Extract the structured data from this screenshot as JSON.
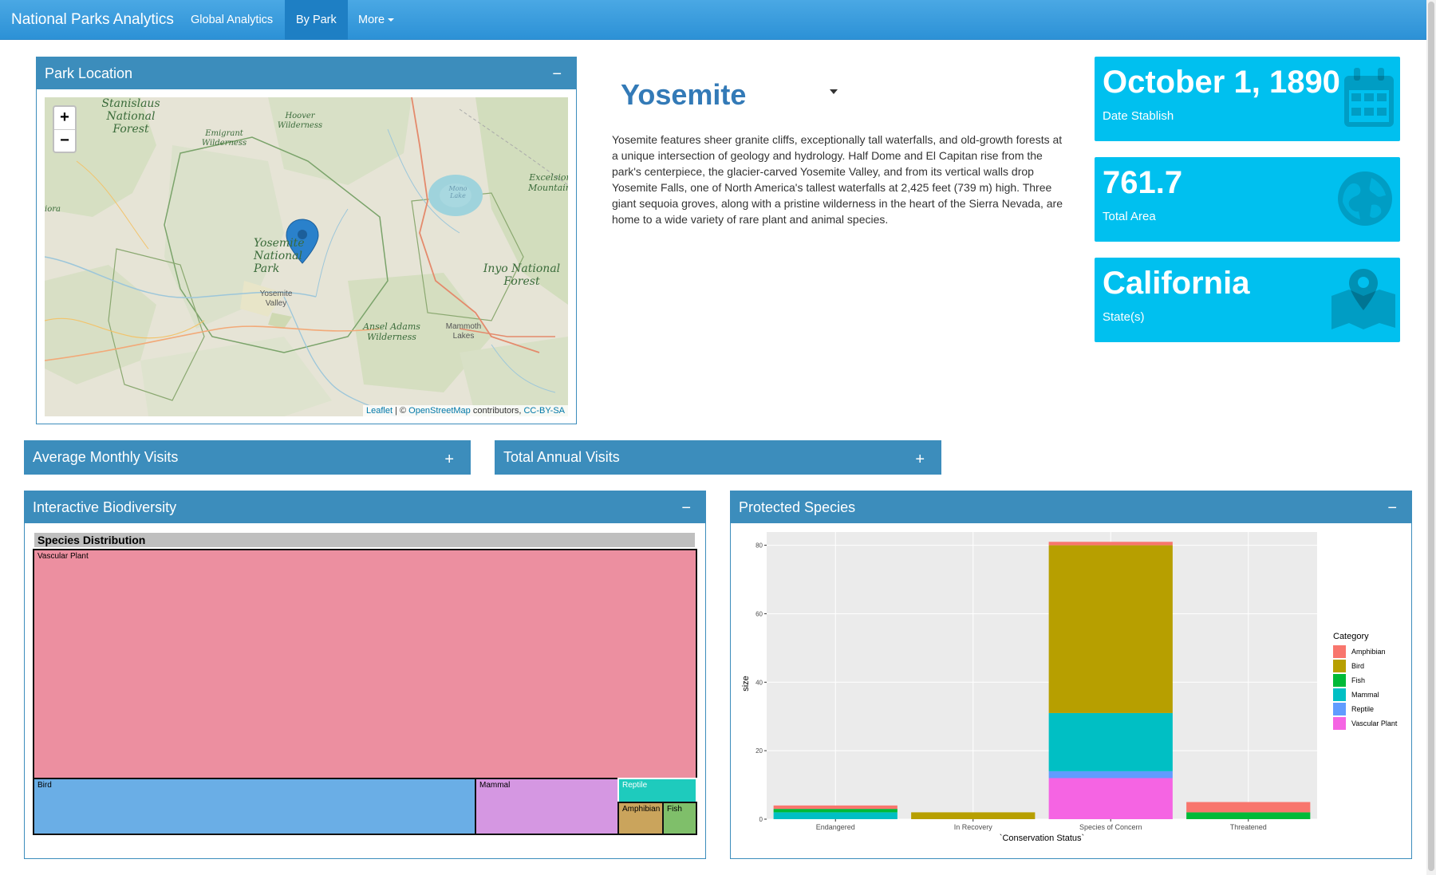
{
  "nav": {
    "brand": "National Parks Analytics",
    "items": [
      "Global Analytics",
      "By Park",
      "More"
    ],
    "active": "By Park"
  },
  "location_box": {
    "title": "Park Location",
    "tool": "−",
    "zoom_in": "+",
    "zoom_out": "−",
    "attribution": {
      "leaflet": "Leaflet",
      "sep": " | © ",
      "osm": "OpenStreetMap",
      "contrib": " contributors, ",
      "license": "CC-BY-SA"
    },
    "labels": {
      "stanislaus": "Stanislaus\nNational\nForest",
      "hoover": "Hoover\nWilderness",
      "emigrant": "Emigrant\nWilderness",
      "mono": "Mono\nLake",
      "excelsior": "Excelsior\nMountain",
      "yosemite_np": "Yosemite\nNational\nPark",
      "yosemite_valley": "Yosemite\nValley",
      "inyo": "Inyo National\nForest",
      "ansel": "Ansel Adams\nWilderness",
      "mammoth": "Mammoth\nLakes",
      "ora": "iora"
    }
  },
  "park": {
    "name": "Yosemite",
    "description": "Yosemite features sheer granite cliffs, exceptionally tall waterfalls, and old-growth forests at a unique intersection of geology and hydrology. Half Dome and El Capitan rise from the park's centerpiece, the glacier-carved Yosemite Valley, and from its vertical walls drop Yosemite Falls, one of North America's tallest waterfalls at 2,425 feet (739 m) high. Three giant sequoia groves, along with a pristine wilderness in the heart of the Sierra Nevada, are home to a wide variety of rare plant and animal species."
  },
  "value_boxes": [
    {
      "value": "October 1, 1890",
      "label": "Date Stablish",
      "icon": "calendar-icon"
    },
    {
      "value": "761.7",
      "label": "Total Area",
      "icon": "globe-icon"
    },
    {
      "value": "California",
      "label": "State(s)",
      "icon": "map-marker-icon"
    }
  ],
  "collapsed_boxes": {
    "monthly": {
      "title": "Average Monthly Visits",
      "tool": "+"
    },
    "annual": {
      "title": "Total Annual Visits",
      "tool": "+"
    }
  },
  "biodiversity": {
    "title": "Interactive Biodiversity",
    "tool": "−",
    "treemap_title": "Species Distribution",
    "cells": [
      {
        "label": "Vascular Plant",
        "color": "#ec8fa0"
      },
      {
        "label": "Bird",
        "color": "#6aaee6"
      },
      {
        "label": "Mammal",
        "color": "#d597e2"
      },
      {
        "label": "Reptile",
        "color": "#1ecbbd"
      },
      {
        "label": "Amphibian",
        "color": "#caa45c"
      },
      {
        "label": "Fish",
        "color": "#7fbf6a"
      }
    ]
  },
  "protected": {
    "title": "Protected Species",
    "tool": "−"
  },
  "chart_data": {
    "type": "bar",
    "stacked": true,
    "xlabel": "`Conservation Status`",
    "ylabel": "size",
    "ylim": [
      0,
      82
    ],
    "yticks": [
      0,
      20,
      40,
      60,
      80
    ],
    "categories": [
      "Endangered",
      "In Recovery",
      "Species of Concern",
      "Threatened"
    ],
    "legend_title": "Category",
    "legend_position": "right",
    "series": [
      {
        "name": "Amphibian",
        "color": "#F8766D",
        "values": [
          1,
          0,
          1,
          3
        ]
      },
      {
        "name": "Bird",
        "color": "#B79F00",
        "values": [
          0,
          2,
          49,
          0
        ]
      },
      {
        "name": "Fish",
        "color": "#00BA38",
        "values": [
          1,
          0,
          0,
          2
        ]
      },
      {
        "name": "Mammal",
        "color": "#00BFC4",
        "values": [
          2,
          0,
          17,
          0
        ]
      },
      {
        "name": "Reptile",
        "color": "#619CFF",
        "values": [
          0,
          0,
          2,
          0
        ]
      },
      {
        "name": "Vascular Plant",
        "color": "#F564E3",
        "values": [
          0,
          0,
          12,
          0
        ]
      }
    ]
  }
}
